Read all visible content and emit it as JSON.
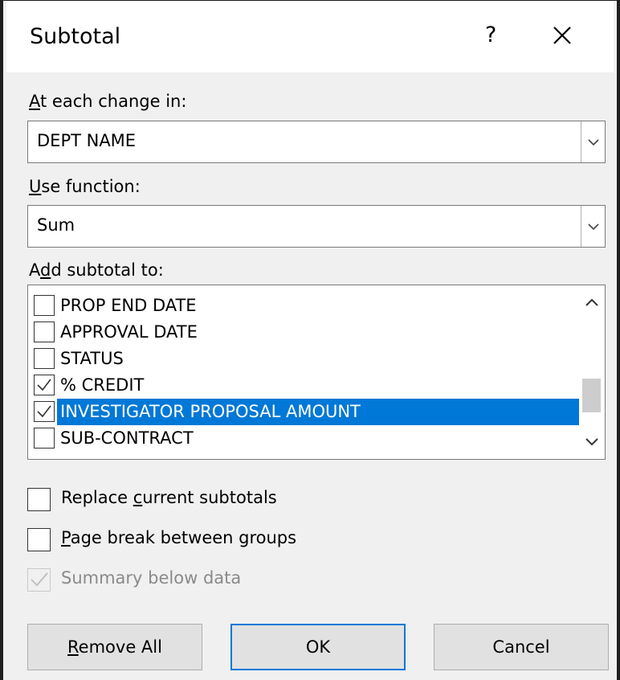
{
  "dialog": {
    "title": "Subtotal",
    "help_label": "?"
  },
  "change_in": {
    "label_accel": "A",
    "label_rest": "t each change in:",
    "value": "DEPT NAME"
  },
  "function": {
    "label_accel": "U",
    "label_rest": "se function:",
    "value": "Sum"
  },
  "add_to": {
    "label_pre": "A",
    "label_accel": "d",
    "label_rest": "d subtotal to:",
    "items": [
      {
        "label": "PROP END DATE",
        "checked": false
      },
      {
        "label": "APPROVAL DATE",
        "checked": false
      },
      {
        "label": "STATUS",
        "checked": false
      },
      {
        "label": "% CREDIT",
        "checked": true
      },
      {
        "label": "INVESTIGATOR PROPOSAL AMOUNT",
        "checked": true,
        "selected": true
      },
      {
        "label": "SUB-CONTRACT",
        "checked": false
      }
    ]
  },
  "options": {
    "replace": {
      "pre": "Replace ",
      "accel": "c",
      "rest": "urrent subtotals",
      "checked": false
    },
    "page_break": {
      "pre": "",
      "accel": "P",
      "rest": "age break between groups",
      "checked": false
    },
    "summary": {
      "label": "Summary below data",
      "checked": true,
      "disabled": true
    }
  },
  "buttons": {
    "remove_accel": "R",
    "remove_rest": "emove All",
    "ok": "OK",
    "cancel": "Cancel"
  },
  "colors": {
    "selection": "#0078d7",
    "default_button_border": "#0078d7"
  }
}
